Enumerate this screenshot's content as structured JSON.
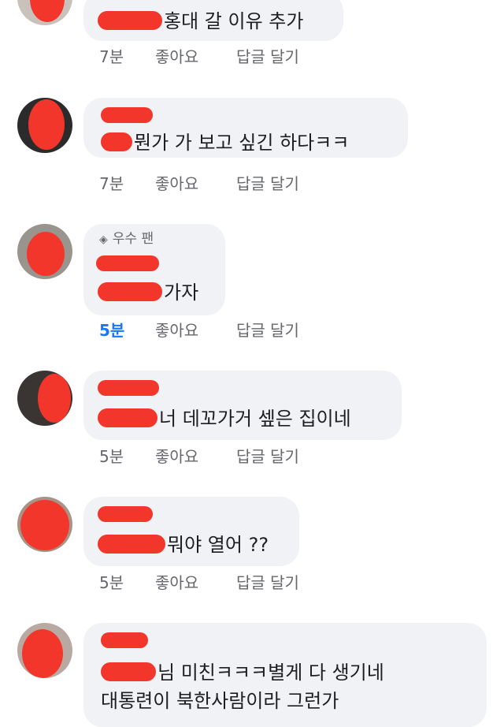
{
  "comments": [
    {
      "text": "홍대 갈 이유 추가",
      "time": "7분",
      "like": "좋아요",
      "reply": "답글 달기",
      "badge": ""
    },
    {
      "text": "뭔가 가 보고 싶긴 하다ㅋㅋ",
      "time": "7분",
      "like": "좋아요",
      "reply": "답글 달기",
      "badge": ""
    },
    {
      "text": "가자",
      "time": "5분",
      "like": "좋아요",
      "reply": "답글 달기",
      "badge": "우수 팬",
      "badge_icon": "diamond-icon",
      "time_color": "#1877f2"
    },
    {
      "text": "너 데꼬가거 셒은 집이네",
      "time": "5분",
      "like": "좋아요",
      "reply": "답글 달기",
      "badge": ""
    },
    {
      "text": "뭐야 열어 ??",
      "time": "5분",
      "like": "좋아요",
      "reply": "답글 달기",
      "badge": ""
    },
    {
      "text": "님 미친ㅋㅋㅋ별게 다 생기네",
      "text2": "대통련이 북한사람이라 그런가",
      "badge": ""
    }
  ],
  "colors": {
    "bubble": "#f0f2f5",
    "meta": "#65676b",
    "redaction": "#f2362b",
    "accent": "#1877f2"
  }
}
